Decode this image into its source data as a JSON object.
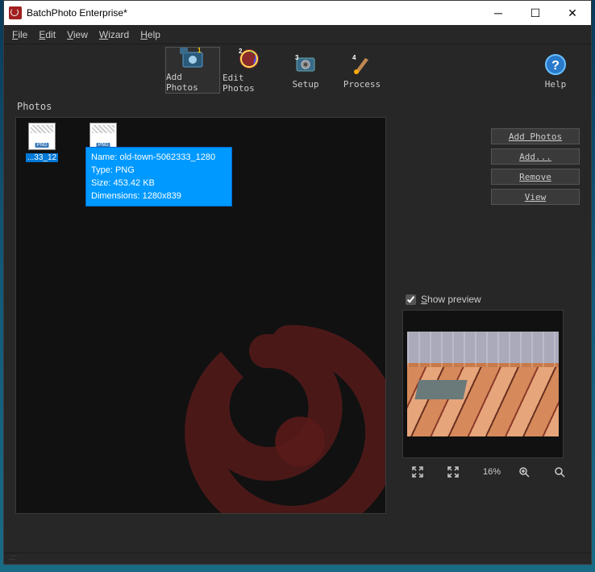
{
  "window": {
    "title": "BatchPhoto Enterprise*"
  },
  "menu": {
    "file": "File",
    "edit": "Edit",
    "view": "View",
    "wizard": "Wizard",
    "help": "Help"
  },
  "toolbar": {
    "add_photos": "Add Photos",
    "edit_photos": "Edit Photos",
    "setup": "Setup",
    "process": "Process",
    "help": "Help"
  },
  "section": {
    "photos": "Photos"
  },
  "thumbs": [
    {
      "label": "...33_12",
      "selected": true
    },
    {
      "label": "",
      "selected": false
    }
  ],
  "tooltip": {
    "line1": "Name: old-town-5062333_1280",
    "line2": "Type: PNG",
    "line3": "Size: 453.42 KB",
    "line4": "Dimensions: 1280x839"
  },
  "buttons": {
    "add_photos": "Add Photos",
    "add": "Add...",
    "remove": "Remove",
    "view": "View"
  },
  "preview": {
    "label": "Show preview",
    "zoom": "16%"
  }
}
